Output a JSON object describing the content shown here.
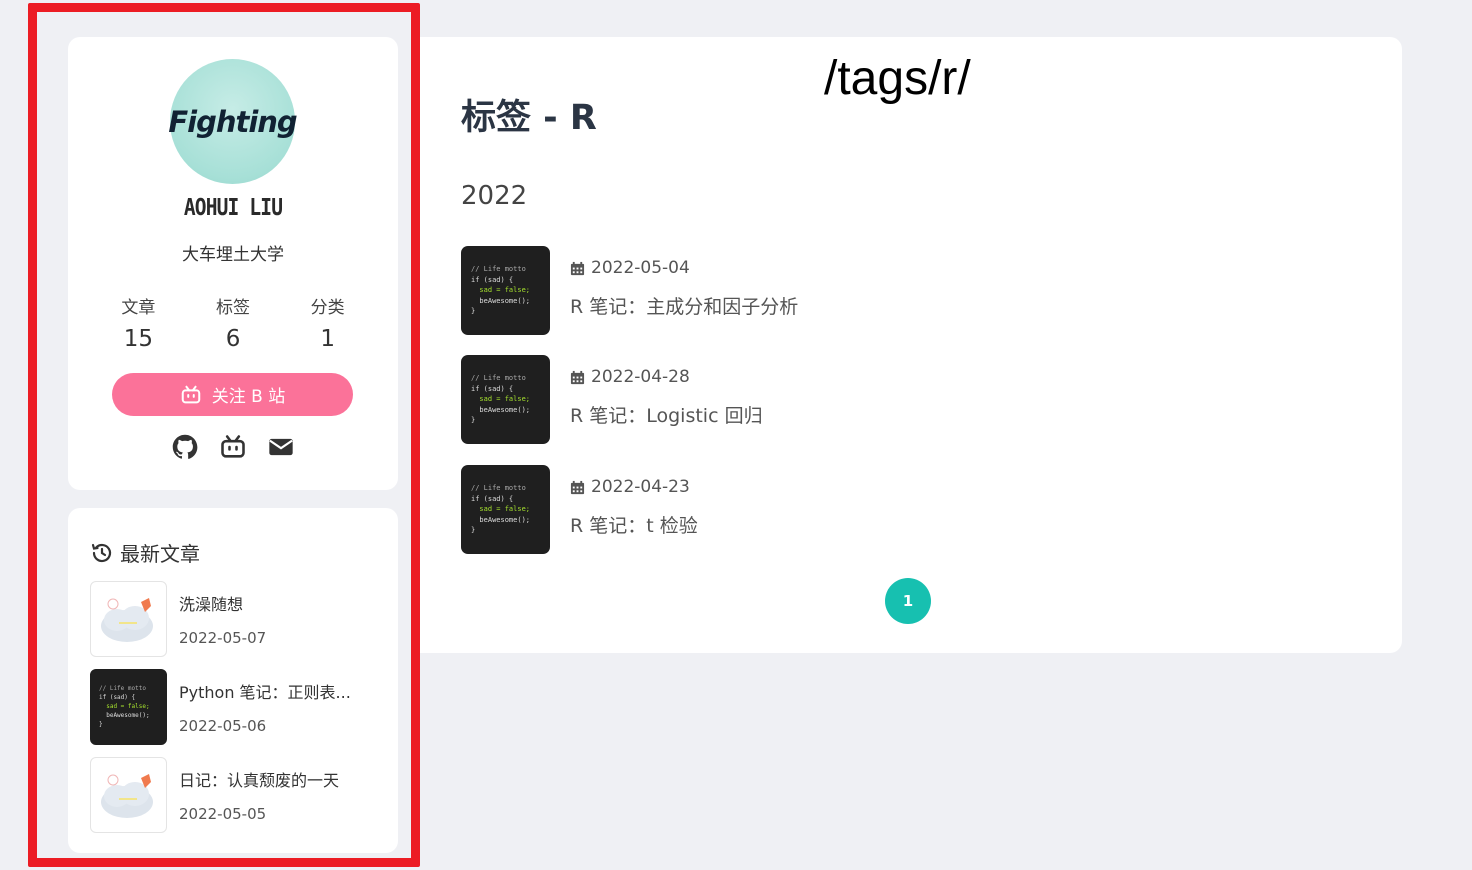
{
  "profile": {
    "avatar_text": "Fighting",
    "name": "AOHUI LIU",
    "description": "大车埋土大学",
    "stats": [
      {
        "label": "文章",
        "value": "15"
      },
      {
        "label": "标签",
        "value": "6"
      },
      {
        "label": "分类",
        "value": "1"
      }
    ],
    "follow_label": "关注 B 站",
    "social_icons": [
      "github-icon",
      "bilibili-icon",
      "mail-icon"
    ],
    "accent_color": "#fb7299"
  },
  "recent": {
    "heading": "最新文章",
    "items": [
      {
        "title": "洗澡随想",
        "date": "2022-05-07",
        "thumb": "cloud"
      },
      {
        "title": "Python 笔记：正则表...",
        "date": "2022-05-06",
        "thumb": "code"
      },
      {
        "title": "日记：认真颓废的一天",
        "date": "2022-05-05",
        "thumb": "cloud"
      }
    ]
  },
  "main": {
    "title": "标签 - R",
    "url_overlay": "/tags/r/",
    "year": "2022",
    "posts": [
      {
        "date": "2022-05-04",
        "title": "R 笔记：主成分和因子分析"
      },
      {
        "date": "2022-04-28",
        "title": "R 笔记：Logistic 回归"
      },
      {
        "date": "2022-04-23",
        "title": "R 笔记：t 检验"
      }
    ],
    "thumb_code": [
      "// Life motto",
      "if (sad) {",
      "  sad = false;",
      "  beAwesome();",
      "}"
    ],
    "page_current": "1",
    "pager_color": "#17c0b0"
  }
}
